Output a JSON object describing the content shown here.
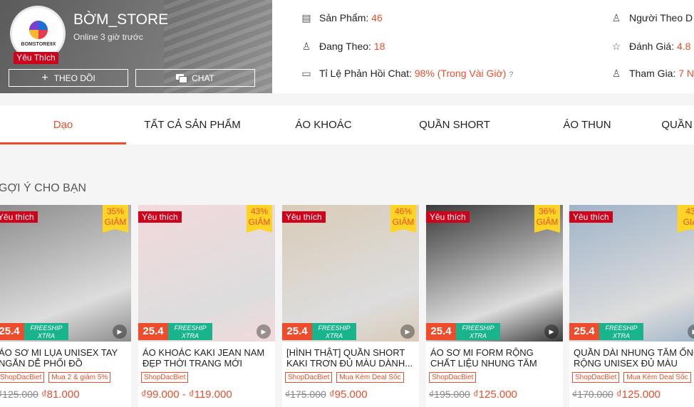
{
  "shop": {
    "name": "BỜM_STORE",
    "online": "Online 3 giờ trước",
    "favorite_badge": "Yêu Thích",
    "follow_label": "THEO DÕI",
    "chat_label": "CHAT",
    "avatar_text": "BOMSTORE9X"
  },
  "stats": {
    "products_label": "Sản Phẩm:",
    "products_value": "46",
    "following_label": "Đang Theo:",
    "following_value": "18",
    "response_label": "Tỉ Lệ Phản Hồi Chat:",
    "response_value": "98% (Trong Vài Giờ)",
    "followers_label": "Người Theo D",
    "rating_label": "Đánh Giá:",
    "rating_value": "4.8 (",
    "joined_label": "Tham Gia:",
    "joined_value": "7 N"
  },
  "tabs": [
    "Dạo",
    "TẤT CẢ SẢN PHẨM",
    "ÁO KHOÁC",
    "QUẦN SHORT",
    "ÁO THUN",
    "QUẦN"
  ],
  "section_title": "GỢI Ý CHO BẠN",
  "products": [
    {
      "fav": "Yêu thích",
      "disc": "35%",
      "disc_word": "GIẢM",
      "promo": "25.4",
      "title": "ÁO SƠ MI LỤA UNISEX TAY NGẮN DỄ PHỐI ĐỒ",
      "tags": [
        "ShopDacBiet",
        "Mua 2 & giảm 5%"
      ],
      "old": "₫125.000",
      "new": "₫81.000",
      "color": "#8c8c8c"
    },
    {
      "fav": "Yêu thích",
      "disc": "43%",
      "disc_word": "GIẢM",
      "promo": "25.4",
      "title": "ÁO KHOÁC KAKI JEAN NAM ĐẸP THỜI TRANG MỚI NHẤ...",
      "tags": [
        "ShopDacBiet"
      ],
      "old": "",
      "new": "₫99.000 - ₫119.000",
      "color": "#f2d9dc"
    },
    {
      "fav": "Yêu thích",
      "disc": "46%",
      "disc_word": "GIẢM",
      "promo": "25.4",
      "title": "[HÌNH THẬT] QUẦN SHORT KAKI TRƠN ĐỦ MÀU DÀNH...",
      "tags": [
        "ShopDacBiet",
        "Mua Kèm Deal Sốc"
      ],
      "old": "₫175.000",
      "new": "₫95.000",
      "color": "#d9cbb7"
    },
    {
      "fav": "Yêu thích",
      "disc": "36%",
      "disc_word": "GIẢM",
      "promo": "25.4",
      "title": "ÁO SƠ MI FORM RỘNG CHẤT LIỆU NHUNG TĂM VINTAGE",
      "tags": [
        "ShopDacBiet"
      ],
      "old": "₫195.000",
      "new": "₫125.000",
      "color": "#3a3a3a"
    },
    {
      "fav": "Yêu thích",
      "disc": "43",
      "disc_word": "GIẢ",
      "promo": "25.4",
      "title": "QUẦN DÀI NHUNG TĂM ỐNG RỘNG UNISEX ĐỦ MÀU",
      "tags": [
        "ShopDacBiet",
        "Mua Kèm Deal Sốc"
      ],
      "old": "₫170.000",
      "new": "₫125.000",
      "color": "#9fb3c8"
    }
  ],
  "freeship": "FREESHIP XTRA"
}
